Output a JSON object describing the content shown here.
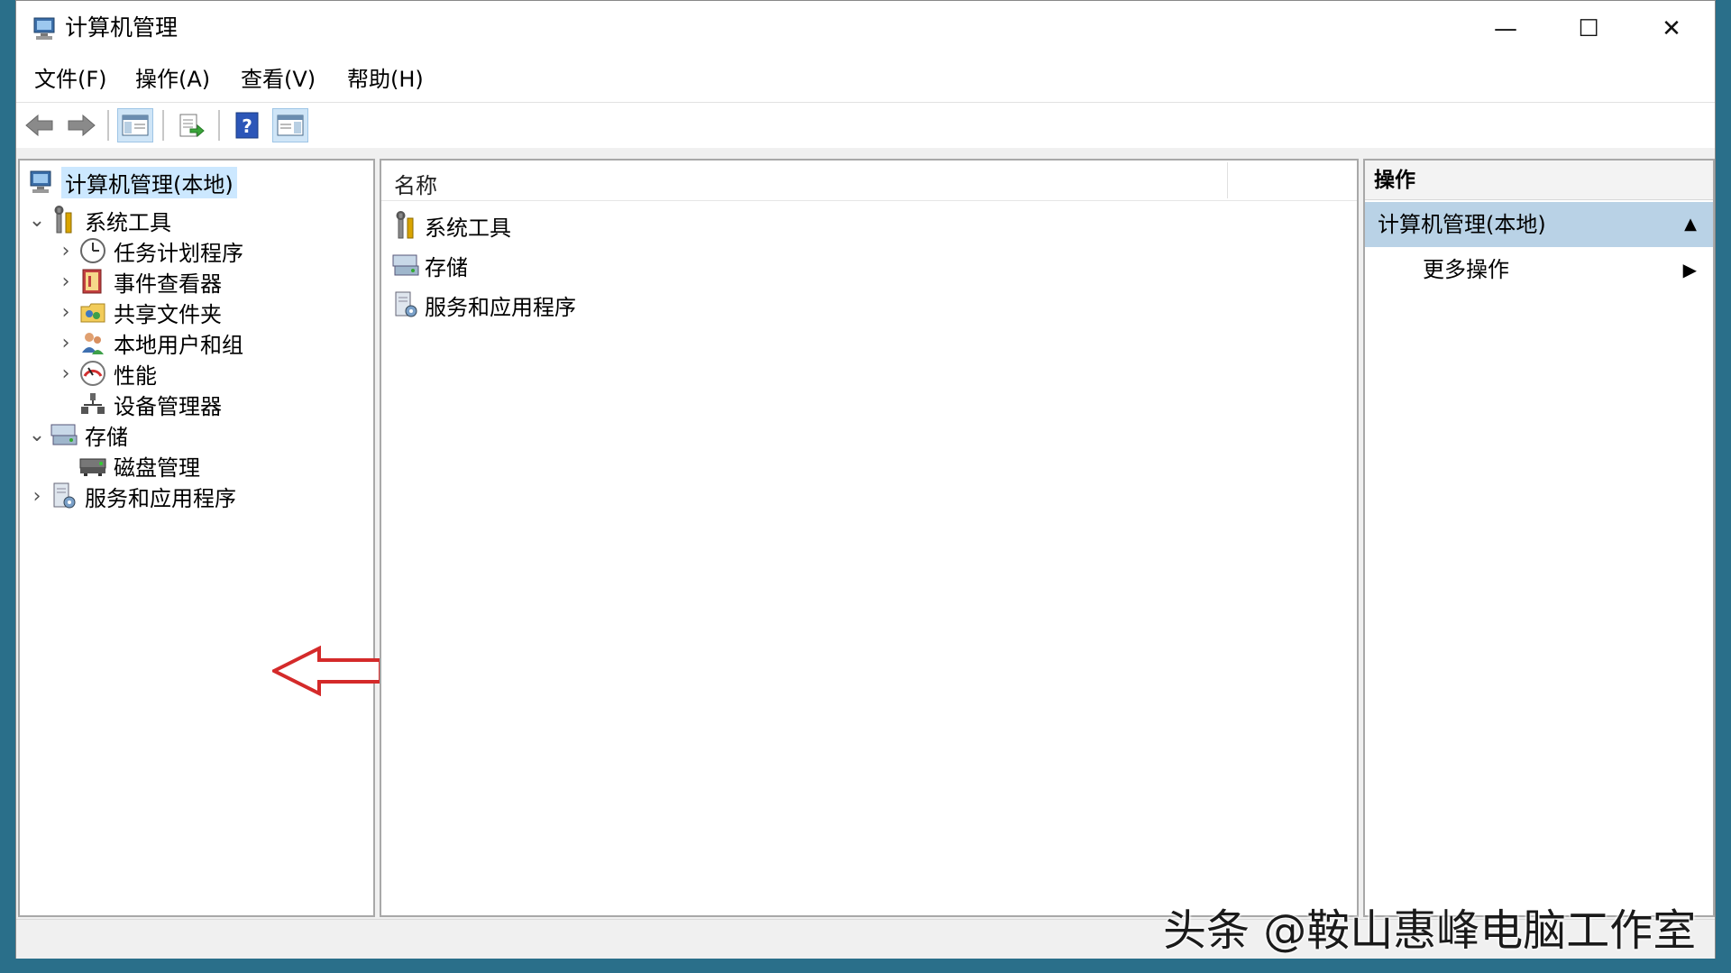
{
  "window": {
    "title": "计算机管理",
    "controls": {
      "minimize": "—",
      "maximize": "☐",
      "close": "✕"
    }
  },
  "menu": [
    {
      "label": "文件(F)"
    },
    {
      "label": "操作(A)"
    },
    {
      "label": "查看(V)"
    },
    {
      "label": "帮助(H)"
    }
  ],
  "toolbar": {
    "icons": [
      "back-arrow-icon",
      "forward-arrow-icon",
      "show-hide-console-tree-icon",
      "export-list-icon",
      "help-icon",
      "show-hide-action-pane-icon"
    ]
  },
  "tree": {
    "root": "计算机管理(本地)",
    "system_tools": "系统工具",
    "task_scheduler": "任务计划程序",
    "event_viewer": "事件查看器",
    "shared_folders": "共享文件夹",
    "local_users": "本地用户和组",
    "performance": "性能",
    "device_manager": "设备管理器",
    "storage": "存储",
    "disk_management": "磁盘管理",
    "services_apps": "服务和应用程序"
  },
  "list": {
    "column_name": "名称",
    "items": [
      "系统工具",
      "存储",
      "服务和应用程序"
    ]
  },
  "actions": {
    "header": "操作",
    "section": "计算机管理(本地)",
    "more": "更多操作"
  },
  "watermark": "头条 @鞍山惠峰电脑工作室",
  "colors": {
    "selection": "#cce8ff",
    "action_section": "#b9d2e6",
    "arrow": "#d42a2a",
    "desktop": "#2a6f8a"
  }
}
